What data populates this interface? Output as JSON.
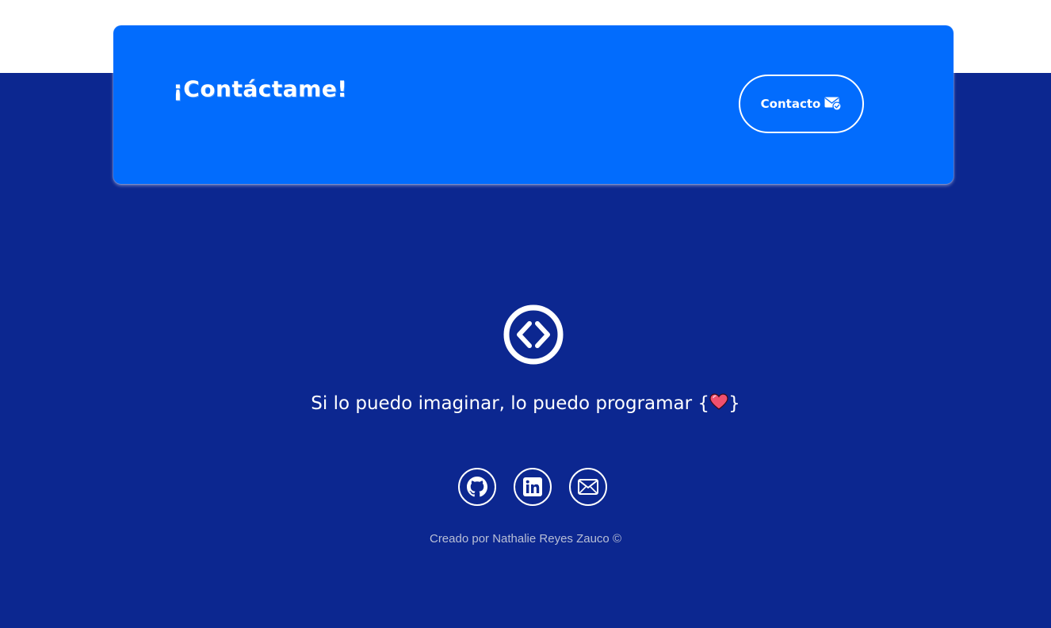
{
  "colors": {
    "page_background": "#0c2790",
    "top_band": "#ffffff",
    "card_background": "#026cfd",
    "text_primary": "#ffffff",
    "text_muted": "#b9bfd6",
    "heart": "#f0506e"
  },
  "contact_card": {
    "heading": "¡Contáctame!",
    "button_label": "Contacto",
    "button_icon": "mail-check-icon"
  },
  "footer": {
    "logo_icon": "code-brackets-circle-icon",
    "tagline_text": "Si lo puedo imaginar, lo puedo programar",
    "tagline_open_brace": "{",
    "tagline_close_brace": "}",
    "tagline_emoji": "heart-icon",
    "social_links": [
      {
        "icon": "github-icon"
      },
      {
        "icon": "linkedin-icon"
      },
      {
        "icon": "email-icon"
      }
    ],
    "credit": "Creado por Nathalie Reyes Zauco ©"
  }
}
